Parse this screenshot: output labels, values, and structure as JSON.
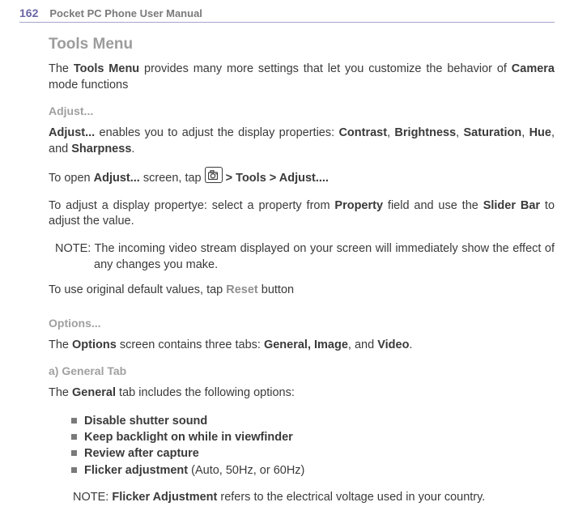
{
  "header": {
    "pageNumber": "162",
    "title": "Pocket PC Phone User Manual"
  },
  "sections": {
    "toolsMenu": {
      "heading": "Tools Menu",
      "p1_a": "The ",
      "p1_b_tools_menu": "Tools Menu",
      "p1_c": " provides many more settings that let you customize the behavior of ",
      "p1_d_camera": "Camera",
      "p1_e": " mode functions"
    },
    "adjust": {
      "heading": "Adjust...",
      "p1_a": "Adjust...",
      "p1_b": " enables you to adjust the display properties: ",
      "p1_c_contrast": "Contrast",
      "p1_d": ", ",
      "p1_e_brightness": "Brightness",
      "p1_f": ", ",
      "p1_g_saturation": "Saturation",
      "p1_h": ", ",
      "p1_i_hue": "Hue",
      "p1_j": ", and ",
      "p1_k_sharpness": "Sharpness",
      "p1_l": ".",
      "p2_a": "To open ",
      "p2_b_adjust": "Adjust...",
      "p2_c": " screen, tap ",
      "p2_d_path": " > Tools > Adjust....",
      "p3_a": "To adjust a display propertye: select a property from ",
      "p3_b_propfield": "Property",
      "p3_c": " field and use the ",
      "p3_d_sliderbar": "Slider Bar",
      "p3_e": " to adjust the value.",
      "note_label": "NOTE: ",
      "note_text": "The incoming video stream displayed on your screen will immediately show the effect of any changes you make.",
      "p4_a": "To use original default values, tap ",
      "p4_b_reset": "Reset",
      "p4_c": " button"
    },
    "options": {
      "heading": "Options...",
      "p1_a": "The ",
      "p1_b_options": "Options",
      "p1_c": " screen contains three tabs:  ",
      "p1_d_tabs": "General, Image",
      "p1_e": ", and ",
      "p1_f_video": "Video",
      "p1_g": "."
    },
    "generalTab": {
      "heading": "a) General Tab",
      "p1_a": "The ",
      "p1_b_general": "General",
      "p1_c": " tab includes the following options:",
      "items": [
        {
          "bold": "Disable shutter sound",
          "rest": ""
        },
        {
          "bold": "Keep backlight on while in viewfinder",
          "rest": ""
        },
        {
          "bold": "Review after capture",
          "rest": ""
        },
        {
          "bold": "Flicker adjustment",
          "rest": " (Auto, 50Hz, or 60Hz)"
        }
      ],
      "note_label": "NOTE: ",
      "note_bold": "Flicker Adjustment",
      "note_rest": " refers to the electrical voltage used in your country."
    }
  }
}
